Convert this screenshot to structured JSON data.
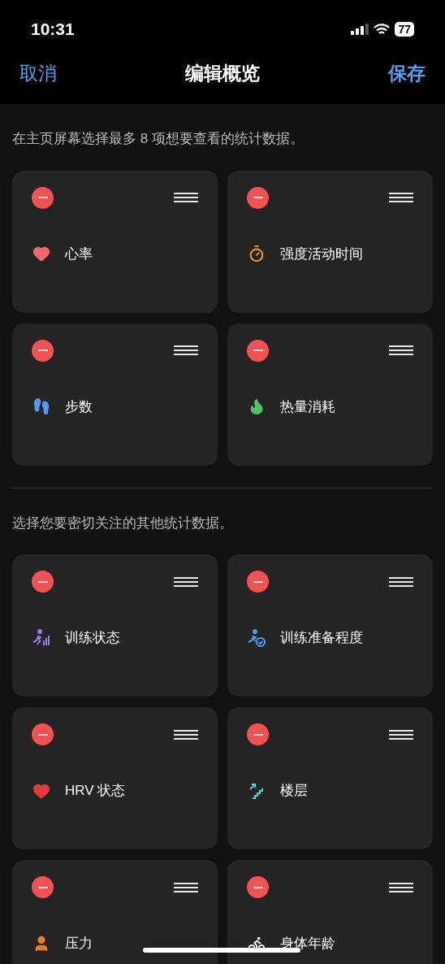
{
  "status_bar": {
    "time": "10:31",
    "battery": "77"
  },
  "nav": {
    "cancel": "取消",
    "title": "编辑概览",
    "save": "保存"
  },
  "sections": [
    {
      "caption": "在主页屏幕选择最多 8 项想要查看的统计数据。",
      "cards": [
        {
          "label": "心率",
          "kind": "heart"
        },
        {
          "label": "强度活动时间",
          "kind": "stopwatch"
        },
        {
          "label": "步数",
          "kind": "footprints"
        },
        {
          "label": "热量消耗",
          "kind": "flame"
        }
      ]
    },
    {
      "caption": "选择您要密切关注的其他统计数据。",
      "cards": [
        {
          "label": "训练状态",
          "kind": "runner-bars"
        },
        {
          "label": "训练准备程度",
          "kind": "runner-check"
        },
        {
          "label": "HRV 状态",
          "kind": "heart-pulse"
        },
        {
          "label": "楼层",
          "kind": "stairs"
        },
        {
          "label": "压力",
          "kind": "person-bolt"
        },
        {
          "label": "身体年龄",
          "kind": "runner-clock"
        }
      ]
    }
  ]
}
